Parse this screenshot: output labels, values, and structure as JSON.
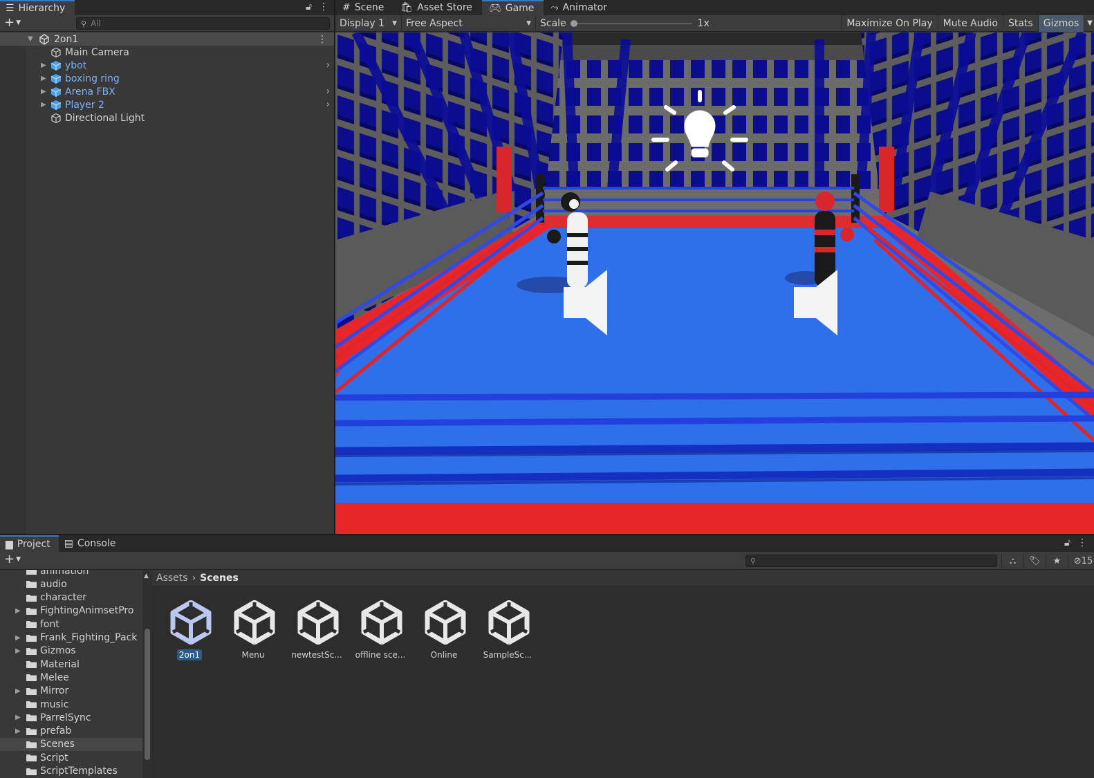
{
  "hierarchy": {
    "tab_label": "Hierarchy",
    "search_placeholder": "All",
    "scene_name": "2on1",
    "items": [
      {
        "label": "Main Camera",
        "type": "gameobject"
      },
      {
        "label": "ybot",
        "type": "prefab"
      },
      {
        "label": "boxing ring",
        "type": "prefab"
      },
      {
        "label": "Arena FBX",
        "type": "prefab"
      },
      {
        "label": "Player 2",
        "type": "prefab"
      },
      {
        "label": "Directional Light",
        "type": "gameobject"
      }
    ]
  },
  "game_view": {
    "tabs": [
      "Scene",
      "Asset Store",
      "Game",
      "Animator"
    ],
    "active_tab": "Game",
    "display": "Display 1",
    "aspect": "Free Aspect",
    "scale_label": "Scale",
    "scale_value": "1x",
    "buttons": [
      "Maximize On Play",
      "Mute Audio",
      "Stats",
      "Gizmos"
    ]
  },
  "project": {
    "tabs": [
      "Project",
      "Console"
    ],
    "active_tab": "Project",
    "folders": [
      {
        "label": "animation",
        "expandable": false
      },
      {
        "label": "audio",
        "expandable": false
      },
      {
        "label": "character",
        "expandable": false
      },
      {
        "label": "FightingAnimsetPro",
        "expandable": true
      },
      {
        "label": "font",
        "expandable": false
      },
      {
        "label": "Frank_Fighting_Pack",
        "expandable": true
      },
      {
        "label": "Gizmos",
        "expandable": true
      },
      {
        "label": "Material",
        "expandable": false
      },
      {
        "label": "Melee",
        "expandable": false
      },
      {
        "label": "Mirror",
        "expandable": true
      },
      {
        "label": "music",
        "expandable": false
      },
      {
        "label": "ParrelSync",
        "expandable": true
      },
      {
        "label": "prefab",
        "expandable": true
      },
      {
        "label": "Scenes",
        "expandable": false
      },
      {
        "label": "Script",
        "expandable": false
      },
      {
        "label": "ScriptTemplates",
        "expandable": false
      }
    ],
    "selected_folder": "Scenes",
    "breadcrumb": [
      "Assets",
      "Scenes"
    ],
    "hidden_count": "15",
    "assets": [
      "2on1",
      "Menu",
      "newtestSc...",
      "offline sce...",
      "Online",
      "SampleSc..."
    ],
    "selected_asset": "2on1"
  },
  "colors": {
    "accent": "#3a79bb",
    "prefab_text": "#7cb1f5",
    "ring_mat": "#2f6fea",
    "ring_apron": "#e8262a",
    "seats": "#0b0d8c"
  }
}
